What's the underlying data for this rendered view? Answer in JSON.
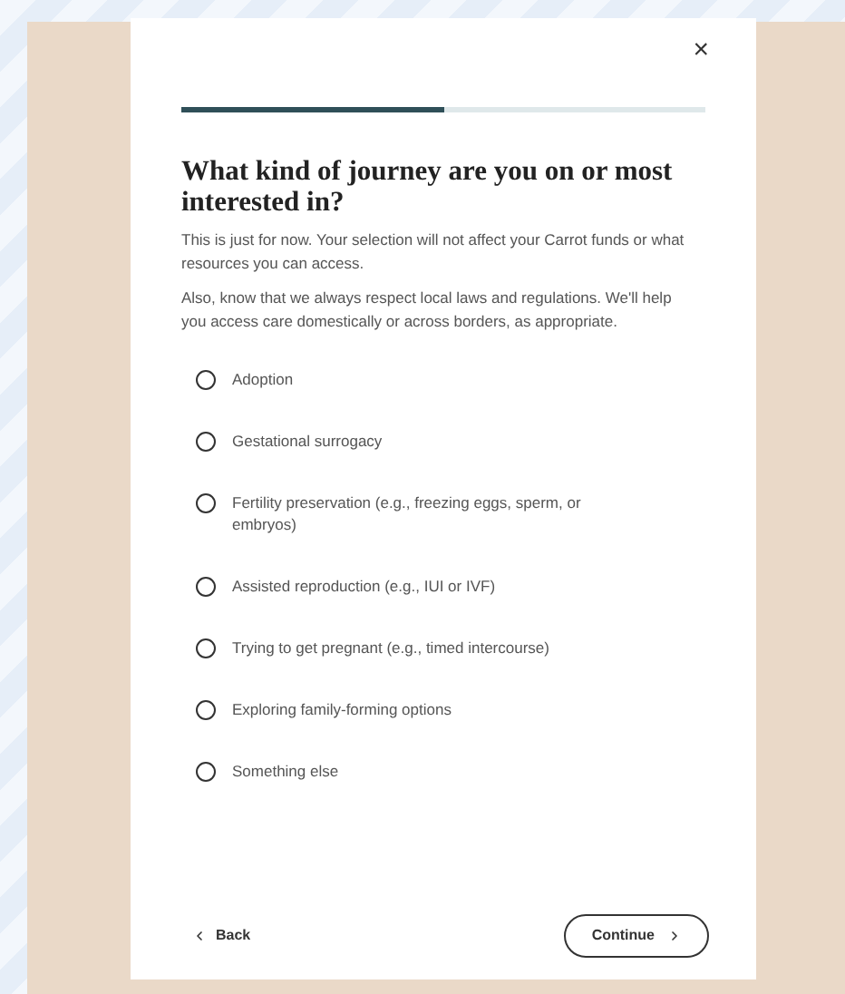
{
  "dialog": {
    "close": "×",
    "progress": {
      "level": 0.5
    },
    "title": "What kind of journey are you on or most interested in?",
    "paragraphs": [
      "This is just for now. Your selection will not affect your Carrot funds or what resources you can access.",
      "Also, know that we always respect local laws and regulations. We'll help you access care domestically or across borders, as appropriate."
    ],
    "options": [
      {
        "label": "Adoption",
        "selected": false
      },
      {
        "label": "Gestational surrogacy",
        "selected": false
      },
      {
        "label": "Fertility preservation (e.g., freezing eggs, sperm, or embryos)",
        "selected": false
      },
      {
        "label": "Assisted reproduction (e.g., IUI or IVF)",
        "selected": false
      },
      {
        "label": "Trying to get pregnant (e.g., timed intercourse)",
        "selected": false
      },
      {
        "label": "Exploring family-forming options",
        "selected": false
      },
      {
        "label": "Something else",
        "selected": false
      }
    ],
    "back": "Back",
    "continue": "Continue"
  }
}
